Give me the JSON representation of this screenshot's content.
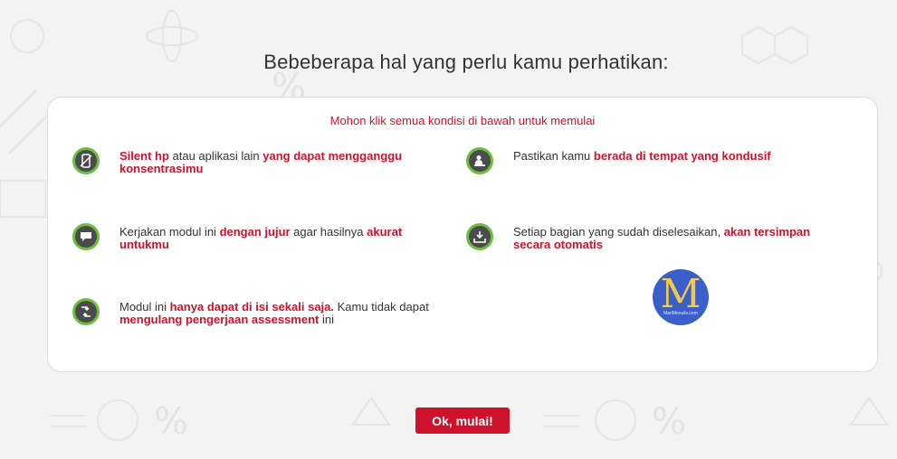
{
  "heading": "Bebeberapa hal yang perlu kamu perhatikan:",
  "instruction": "Mohon klik semua kondisi di bawah untuk memulai",
  "items": [
    {
      "icon": "phone-icon",
      "parts": [
        {
          "t": "Silent hp",
          "b": true
        },
        {
          "t": " atau aplikasi lain ",
          "b": false
        },
        {
          "t": "yang dapat mengganggu konsentrasimu",
          "b": true
        }
      ]
    },
    {
      "icon": "person-desk-icon",
      "parts": [
        {
          "t": "Pastikan kamu ",
          "b": false
        },
        {
          "t": "berada di tempat yang kondusif",
          "b": true
        }
      ]
    },
    {
      "icon": "chat-icon",
      "parts": [
        {
          "t": "Kerjakan modul ini ",
          "b": false
        },
        {
          "t": "dengan jujur",
          "b": true
        },
        {
          "t": " agar hasilnya ",
          "b": false
        },
        {
          "t": "akurat untukmu",
          "b": true
        }
      ]
    },
    {
      "icon": "save-download-icon",
      "parts": [
        {
          "t": "Setiap bagian yang sudah diselesaikan, ",
          "b": false
        },
        {
          "t": "akan tersimpan secara otomatis",
          "b": true
        }
      ]
    },
    {
      "icon": "no-repeat-icon",
      "parts": [
        {
          "t": "Modul ini ",
          "b": false
        },
        {
          "t": "hanya dapat di isi sekali saja.",
          "b": true
        },
        {
          "t": " Kamu tidak dapat ",
          "b": false
        },
        {
          "t": "mengulang pengerjaan assessment",
          "b": true
        },
        {
          "t": " ini",
          "b": false
        }
      ]
    }
  ],
  "watermark": {
    "letter": "M",
    "caption": "MariMenulis.com"
  },
  "start_button": "Ok, mulai!",
  "colors": {
    "accent": "#d0112b",
    "icon_ring": "#6bbf3f",
    "icon_fill": "#4b4b4b"
  }
}
